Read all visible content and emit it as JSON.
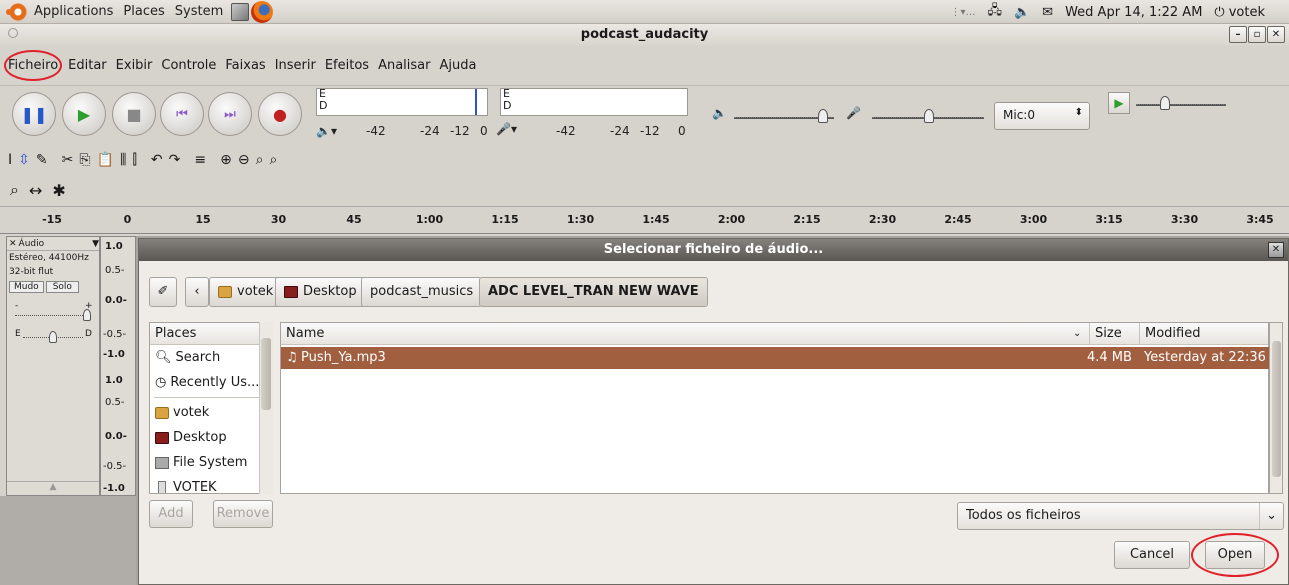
{
  "panel": {
    "menus": [
      "Applications",
      "Places",
      "System"
    ],
    "clock": "Wed Apr 14,  1:22 AM",
    "user": "votek"
  },
  "window": {
    "title": "podcast_audacity"
  },
  "menubar": [
    "Ficheiro",
    "Editar",
    "Exibir",
    "Controle",
    "Faixas",
    "Inserir",
    "Efeitos",
    "Analisar",
    "Ajuda"
  ],
  "meters": {
    "labels_e": "E",
    "labels_d": "D",
    "ticks": [
      "-42",
      "-24",
      "-12",
      "0"
    ],
    "mic": "Mic:0"
  },
  "ruler": [
    "-15",
    "0",
    "15",
    "30",
    "45",
    "1:00",
    "1:15",
    "1:30",
    "1:45",
    "2:00",
    "2:15",
    "2:30",
    "2:45",
    "3:00",
    "3:15",
    "3:30",
    "3:45"
  ],
  "track": {
    "name": "Áudio",
    "info1": "Estéreo, 44100Hz",
    "info2": "32-bit flut",
    "mute": "Mudo",
    "solo": "Solo",
    "gain_left": "-",
    "gain_right": "+",
    "pan_left": "E",
    "pan_right": "D",
    "scale": [
      "1.0",
      "0.5-",
      "0.0-",
      "-0.5-",
      "-1.0",
      "1.0",
      "0.5-",
      "0.0-",
      "-0.5-",
      "-1.0"
    ]
  },
  "dialog": {
    "title": "Selecionar ficheiro de áudio...",
    "breadcrumbs": [
      "votek",
      "Desktop",
      "podcast_musics",
      "ADC LEVEL_TRAN NEW WAVE"
    ],
    "places_header": "Places",
    "places": [
      "Search",
      "Recently Us...",
      "votek",
      "Desktop",
      "File System",
      "VOTEK"
    ],
    "columns": {
      "name": "Name",
      "size": "Size",
      "modified": "Modified"
    },
    "files": [
      {
        "name": "Push_Ya.mp3",
        "size": "4.4 MB",
        "modified": "Yesterday at 22:36"
      }
    ],
    "add": "Add",
    "remove": "Remove",
    "filter": "Todos os ficheiros",
    "cancel": "Cancel",
    "open": "Open"
  }
}
